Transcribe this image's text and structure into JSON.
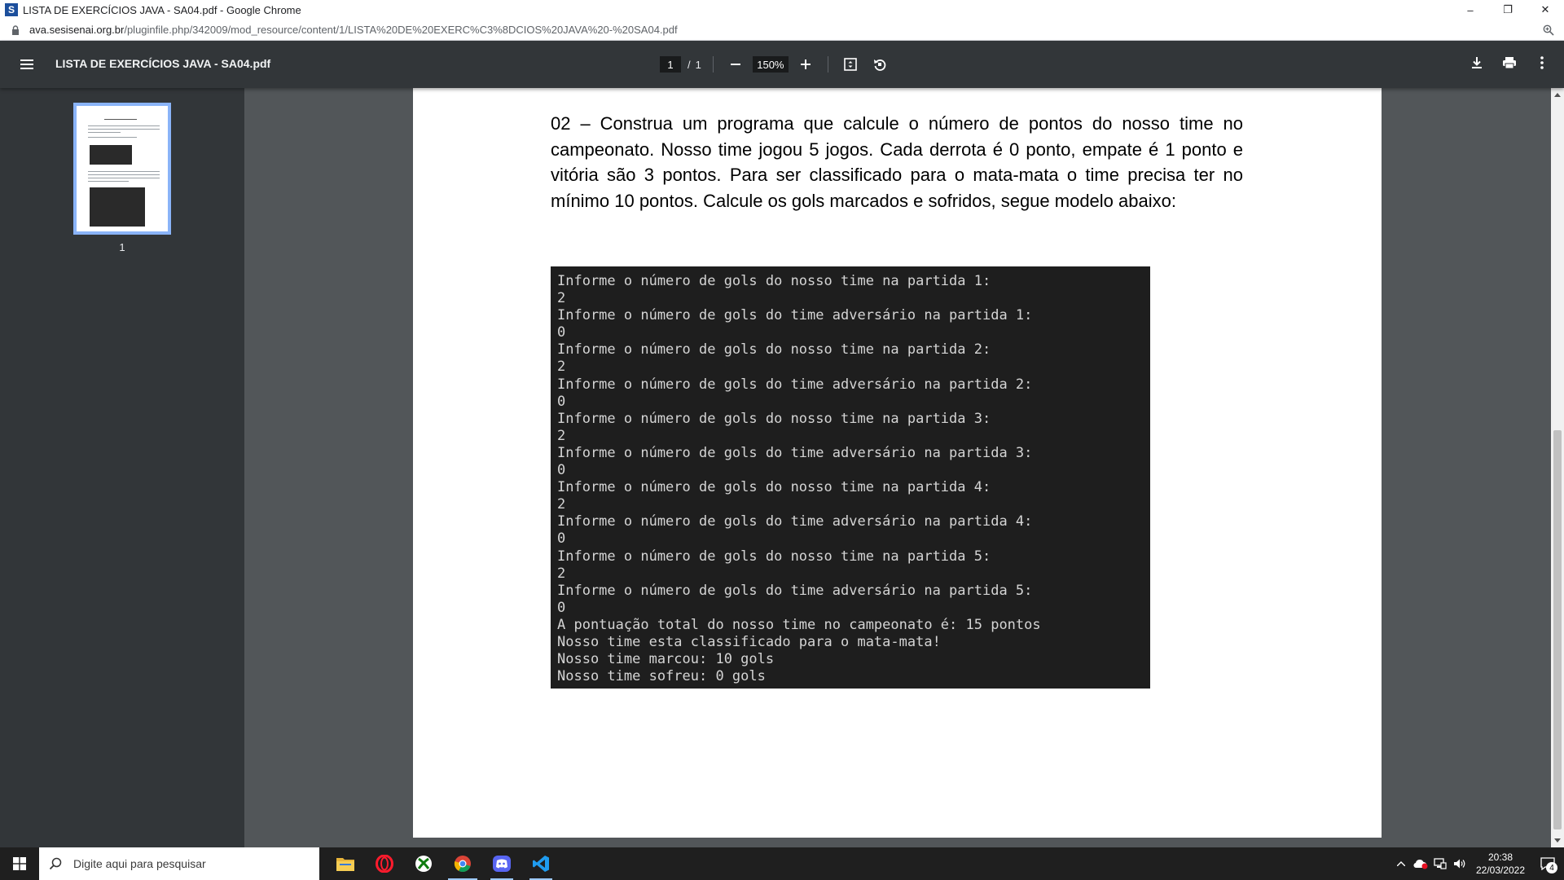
{
  "browser": {
    "window_title": "LISTA DE EXERCÍCIOS JAVA - SA04.pdf - Google Chrome",
    "favicon_letter": "S",
    "url_host": "ava.sesisenai.org.br",
    "url_path": "/pluginfile.php/342009/mod_resource/content/1/LISTA%20DE%20EXERC%C3%8DCIOS%20JAVA%20-%20SA04.pdf",
    "controls": {
      "minimize": "–",
      "restore": "❐",
      "close": "✕"
    }
  },
  "pdf_toolbar": {
    "title": "LISTA DE EXERCÍCIOS JAVA - SA04.pdf",
    "current_page": "1",
    "separator": "/",
    "total_pages": "1",
    "zoom": "150%"
  },
  "sidebar": {
    "thumbnails": [
      {
        "label": "1",
        "selected": true
      }
    ]
  },
  "document": {
    "paragraph": "02 – Construa um programa que calcule o número de pontos do nosso time no campeonato. Nosso time jogou 5 jogos. Cada derrota é 0 ponto, empate é 1 ponto e vitória são 3 pontos. Para ser classificado para o mata-mata o time precisa ter no mínimo 10 pontos. Calcule os gols marcados e sofridos, segue modelo abaixo:",
    "console_lines": [
      "Informe o número de gols do nosso time na partida 1:",
      "2",
      "Informe o número de gols do time adversário na partida 1:",
      "0",
      "Informe o número de gols do nosso time na partida 2:",
      "2",
      "Informe o número de gols do time adversário na partida 2:",
      "0",
      "Informe o número de gols do nosso time na partida 3:",
      "2",
      "Informe o número de gols do time adversário na partida 3:",
      "0",
      "Informe o número de gols do nosso time na partida 4:",
      "2",
      "Informe o número de gols do time adversário na partida 4:",
      "0",
      "Informe o número de gols do nosso time na partida 5:",
      "2",
      "Informe o número de gols do time adversário na partida 5:",
      "0",
      "A pontuação total do nosso time no campeonato é: 15 pontos",
      "Nosso time esta classificado para o mata-mata!",
      "Nosso time marcou: 10 gols",
      "Nosso time sofreu: 0 gols"
    ]
  },
  "taskbar": {
    "search_placeholder": "Digite aqui para pesquisar",
    "apps": [
      "file-explorer",
      "opera",
      "xbox",
      "chrome",
      "discord",
      "vscode"
    ],
    "time": "20:38",
    "date": "22/03/2022",
    "notification_count": "4"
  },
  "colors": {
    "toolbar": "#323639",
    "viewer_bg": "#525659",
    "console_bg": "#1e1e1e",
    "thumb_selected": "#8ab4f8"
  }
}
